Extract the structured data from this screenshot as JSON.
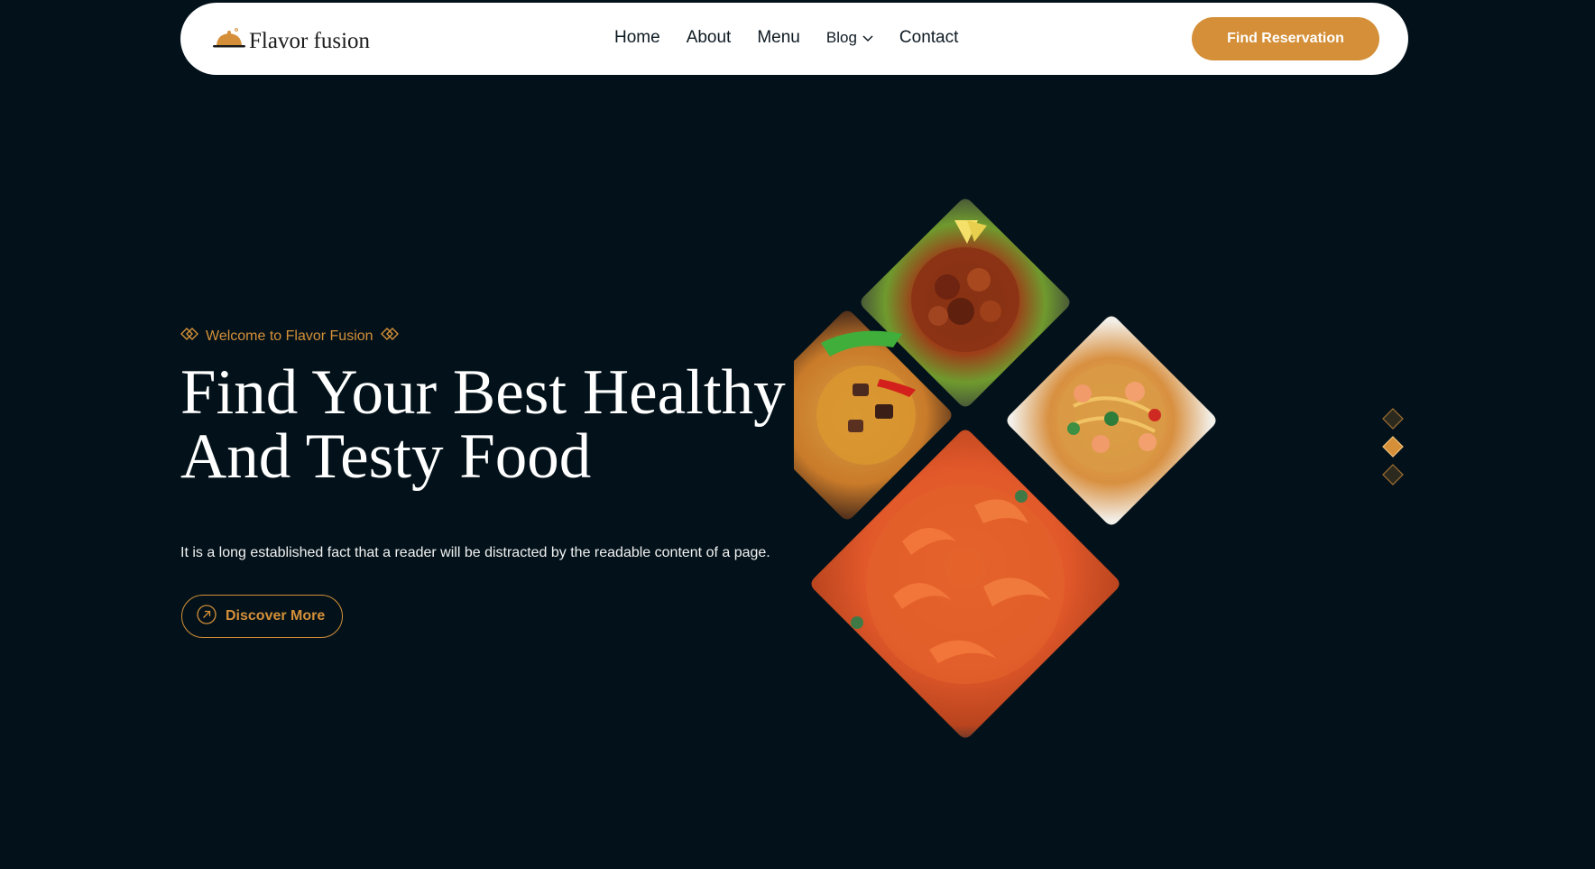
{
  "brand": {
    "name": "Flavor fusion"
  },
  "nav": {
    "items": [
      "Home",
      "About",
      "Menu",
      "Blog",
      "Contact"
    ],
    "cta": "Find Reservation"
  },
  "hero": {
    "eyebrow": "Welcome to Flavor Fusion",
    "title_line1": "Find Your Best Healthy",
    "title_line2": "And Testy Food",
    "description": "It is a long established fact that a reader will be distracted by the readable content of a page.",
    "cta": "Discover More"
  },
  "gallery": {
    "images": [
      "fried-chicken-on-lettuce",
      "rice-with-beef-and-pepper",
      "shrimp-noodles",
      "grilled-prawns"
    ]
  },
  "slider": {
    "total": 3,
    "active_index": 1
  },
  "colors": {
    "background": "#03121a",
    "accent": "#d48f38",
    "nav_bg": "#ffffff",
    "text_dark": "#0e1a22",
    "text_light": "#ffffff"
  }
}
